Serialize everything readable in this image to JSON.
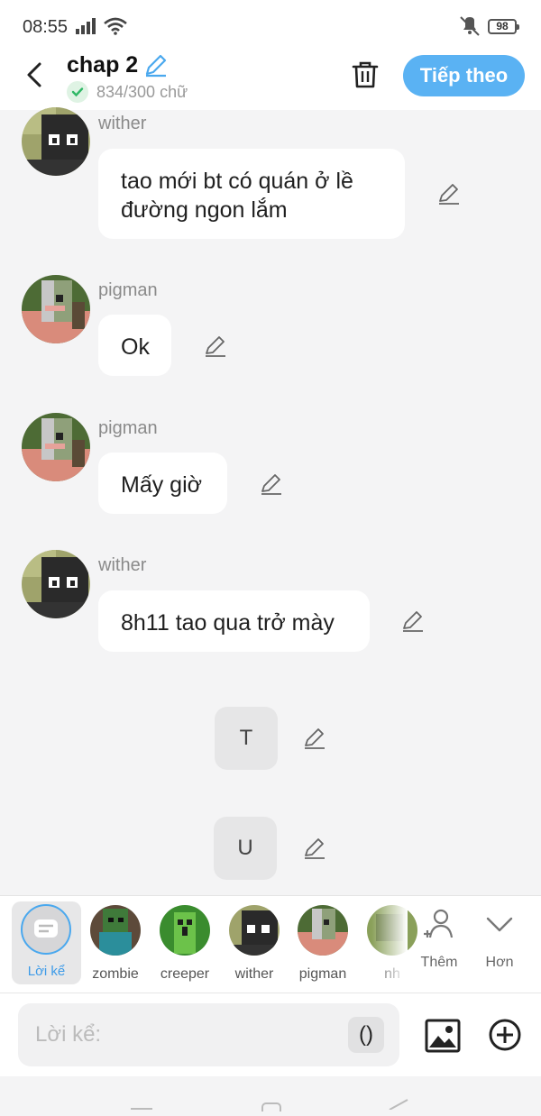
{
  "status": {
    "time": "08:55",
    "battery": "98"
  },
  "header": {
    "title": "chap 2",
    "count": "834/300 chữ",
    "next_label": "Tiếp theo"
  },
  "messages": [
    {
      "name": "wither",
      "text": "tao mới bt có quán ở lề đường ngon lắm"
    },
    {
      "name": "pigman",
      "text": "Ok"
    },
    {
      "name": "pigman",
      "text": "Mấy giờ"
    },
    {
      "name": "wither",
      "text": "8h11 tao qua trở mày"
    }
  ],
  "narration": [
    {
      "text": "T"
    },
    {
      "text": "U"
    }
  ],
  "characters": {
    "narrator_label": "Lời kể",
    "items": [
      {
        "name": "zombie"
      },
      {
        "name": "creeper"
      },
      {
        "name": "wither"
      },
      {
        "name": "pigman"
      },
      {
        "name": "nh"
      }
    ],
    "add_label": "Thêm",
    "more_label": "Hơn"
  },
  "input": {
    "placeholder": "Lời kể:",
    "paren_label": "()"
  },
  "colors": {
    "accent": "#5ab2f3",
    "bubble": "#ffffff",
    "background": "#f4f4f5",
    "check": "#2fb866"
  }
}
